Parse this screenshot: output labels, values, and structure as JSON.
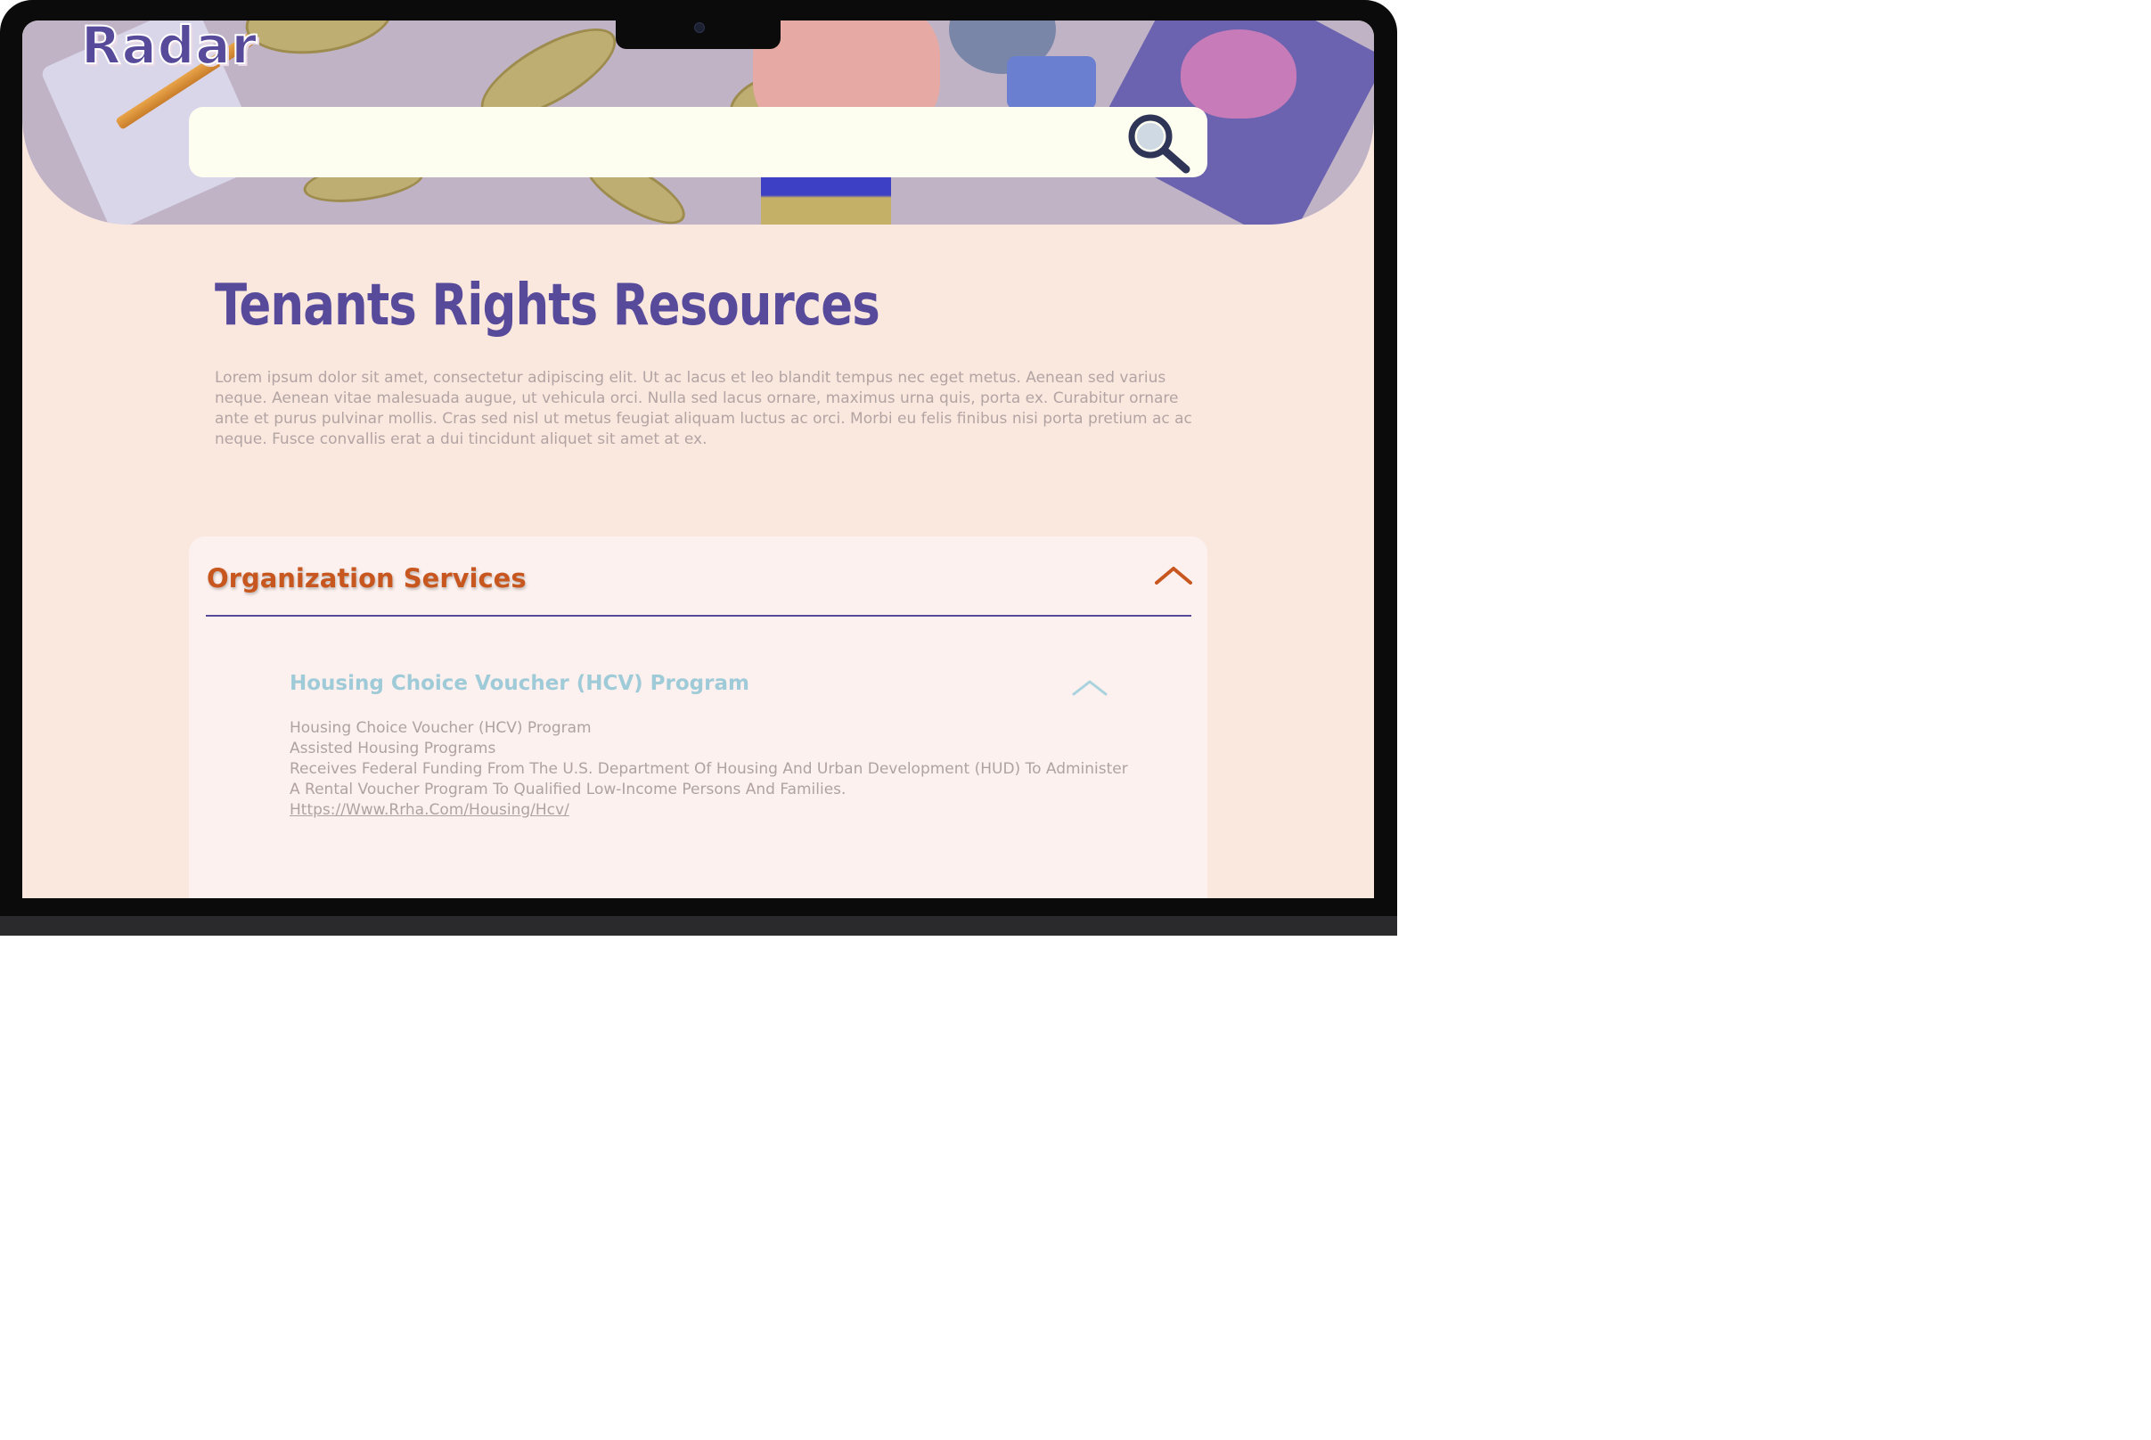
{
  "app": {
    "logo_text": "Radar"
  },
  "search": {
    "placeholder": "",
    "value": "",
    "icon": "magnifier-icon"
  },
  "page": {
    "title": "Tenants Rights Resources",
    "intro": "Lorem ipsum dolor sit amet, consectetur adipiscing elit. Ut ac lacus et leo blandit tempus nec eget metus. Aenean sed varius neque. Aenean vitae malesuada augue, ut vehicula orci. Nulla sed lacus ornare, maximus urna quis, porta ex. Curabitur ornare ante et purus pulvinar mollis. Cras sed nisl ut metus feugiat aliquam luctus ac orci. Morbi eu felis finibus nisi porta pretium ac ac neque. Fusce convallis erat a dui tincidunt aliquet sit amet at ex."
  },
  "section": {
    "title": "Organization Services",
    "expanded": true,
    "toggle_icon": "chevron-up-icon",
    "accent_color": "#c8571f",
    "items": [
      {
        "title": "Housing Choice Voucher (HCV) Program",
        "expanded": true,
        "toggle_icon": "chevron-up-icon",
        "lines": [
          "Housing Choice Voucher (HCV) Program",
          "Assisted Housing Programs",
          "Receives Federal Funding From The U.S. Department Of Housing And Urban Development (HUD) To Administer",
          "A Rental Voucher Program To Qualified Low-Income Persons And Families."
        ],
        "link": "Https://Www.Rrha.Com/Housing/Hcv/"
      }
    ]
  },
  "colors": {
    "brand_purple": "#574a9a",
    "page_background": "#fae8df",
    "hero_background": "#c0b3c6",
    "item_title": "#9fcbd9"
  }
}
